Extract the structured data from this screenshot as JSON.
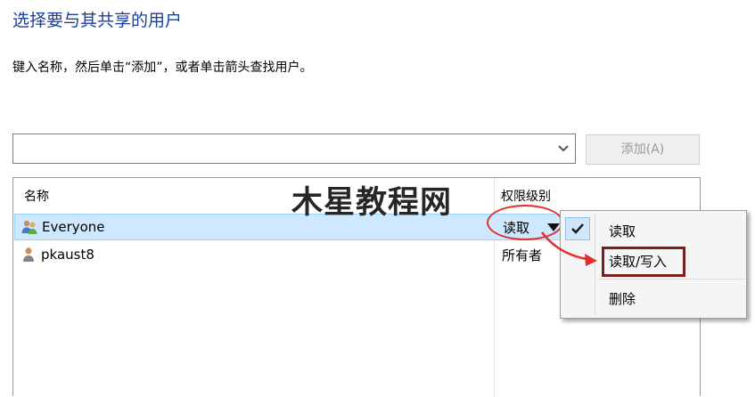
{
  "header": {
    "title": "选择要与其共享的用户",
    "instruction": "键入名称，然后单击“添加”，或者单击箭头查找用户。"
  },
  "picker": {
    "input_value": "",
    "add_button_label": "添加(A)"
  },
  "list": {
    "columns": {
      "name": "名称",
      "permission": "权限级别"
    },
    "rows": [
      {
        "name": "Everyone",
        "permission": "读取",
        "icon": "group-users-icon",
        "selected": true
      },
      {
        "name": "pkaust8",
        "permission": "所有者",
        "icon": "user-icon",
        "selected": false
      }
    ]
  },
  "permission_menu": {
    "items": [
      {
        "label": "读取",
        "checked": true
      },
      {
        "label": "读取/写入",
        "checked": false
      },
      {
        "label": "删除",
        "checked": false
      }
    ]
  },
  "watermark": "木星教程网",
  "colors": {
    "title": "#1c3f9c",
    "selection": "#cde8ff",
    "annotation_red": "#e0312f",
    "highlight_box": "#7a1d1d"
  }
}
